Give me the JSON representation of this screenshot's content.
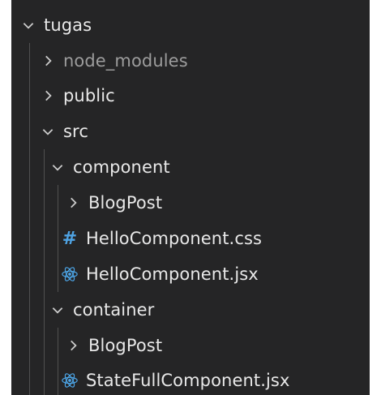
{
  "explorer": {
    "root": {
      "label": "tugas",
      "expanded": true,
      "icon": "chevron-down-icon"
    },
    "items": [
      {
        "label": "node_modules",
        "type": "folder",
        "expanded": false,
        "dimmed": true,
        "icon": "chevron-right-icon"
      },
      {
        "label": "public",
        "type": "folder",
        "expanded": false,
        "icon": "chevron-right-icon"
      },
      {
        "label": "src",
        "type": "folder",
        "expanded": true,
        "icon": "chevron-down-icon"
      },
      {
        "label": "component",
        "type": "folder",
        "expanded": true,
        "icon": "chevron-down-icon"
      },
      {
        "label": "BlogPost",
        "type": "folder",
        "expanded": false,
        "icon": "chevron-right-icon"
      },
      {
        "label": "HelloComponent.css",
        "type": "file",
        "file_icon": "css-hash-icon",
        "icon_text": "#"
      },
      {
        "label": "HelloComponent.jsx",
        "type": "file",
        "file_icon": "react-icon"
      },
      {
        "label": "container",
        "type": "folder",
        "expanded": true,
        "icon": "chevron-down-icon"
      },
      {
        "label": "BlogPost",
        "type": "folder",
        "expanded": false,
        "icon": "chevron-right-icon"
      },
      {
        "label": "StateFullComponent.jsx",
        "type": "file",
        "file_icon": "react-icon"
      }
    ]
  },
  "colors": {
    "panel_background": "#252526",
    "text": "#e8e8e8",
    "dimmed_text": "#9c9c9c",
    "indent_guide": "#505050",
    "css_icon": "#4fa3e3",
    "react_icon": "#4da6e8"
  }
}
